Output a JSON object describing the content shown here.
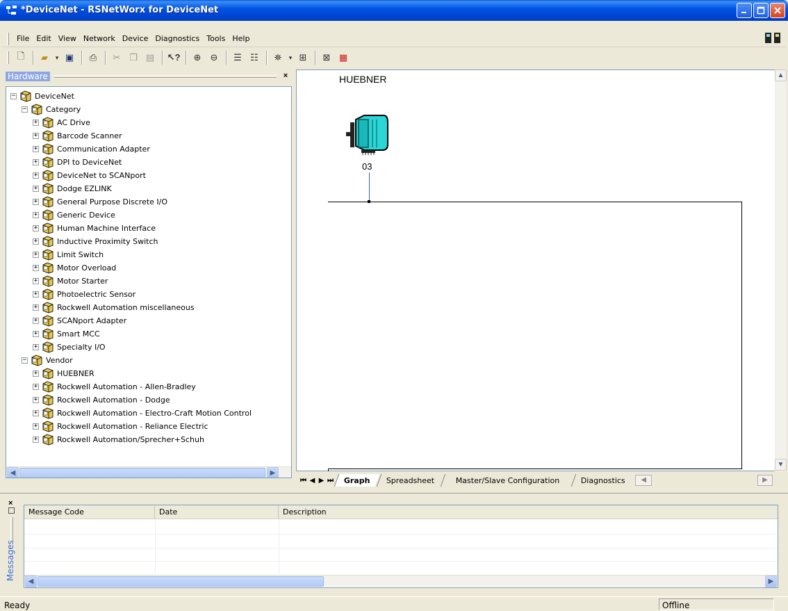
{
  "window": {
    "title": "*DeviceNet - RSNetWorx for DeviceNet"
  },
  "menu": {
    "items": [
      {
        "label": "File"
      },
      {
        "label": "Edit"
      },
      {
        "label": "View"
      },
      {
        "label": "Network"
      },
      {
        "label": "Device"
      },
      {
        "label": "Diagnostics"
      },
      {
        "label": "Tools"
      },
      {
        "label": "Help"
      }
    ]
  },
  "hardware": {
    "title": "Hardware",
    "tree": [
      {
        "label": "DeviceNet",
        "expander": "−"
      },
      {
        "label": "Category",
        "expander": "−"
      },
      {
        "label": "AC Drive",
        "expander": "+"
      },
      {
        "label": "Barcode Scanner",
        "expander": "+"
      },
      {
        "label": "Communication Adapter",
        "expander": "+"
      },
      {
        "label": "DPI to DeviceNet",
        "expander": "+"
      },
      {
        "label": "DeviceNet to SCANport",
        "expander": "+"
      },
      {
        "label": "Dodge EZLINK",
        "expander": "+"
      },
      {
        "label": "General Purpose Discrete I/O",
        "expander": "+"
      },
      {
        "label": "Generic Device",
        "expander": "+"
      },
      {
        "label": "Human Machine Interface",
        "expander": "+"
      },
      {
        "label": "Inductive Proximity Switch",
        "expander": "+"
      },
      {
        "label": "Limit Switch",
        "expander": "+"
      },
      {
        "label": "Motor Overload",
        "expander": "+"
      },
      {
        "label": "Motor Starter",
        "expander": "+"
      },
      {
        "label": "Photoelectric Sensor",
        "expander": "+"
      },
      {
        "label": "Rockwell Automation miscellaneous",
        "expander": "+"
      },
      {
        "label": "SCANport Adapter",
        "expander": "+"
      },
      {
        "label": "Smart MCC",
        "expander": "+"
      },
      {
        "label": "Specialty I/O",
        "expander": "+"
      },
      {
        "label": "Vendor",
        "expander": "−"
      },
      {
        "label": "HUEBNER",
        "expander": "+"
      },
      {
        "label": "Rockwell Automation - Allen-Bradley",
        "expander": "+"
      },
      {
        "label": "Rockwell Automation - Dodge",
        "expander": "+"
      },
      {
        "label": "Rockwell Automation - Electro-Craft Motion Control",
        "expander": "+"
      },
      {
        "label": "Rockwell Automation - Reliance Electric",
        "expander": "+"
      },
      {
        "label": "Rockwell Automation/Sprecher+Schuh",
        "expander": "+"
      }
    ]
  },
  "graph": {
    "network_label": "HUEBNER",
    "node": {
      "address": "03",
      "icon": "drive-device-icon",
      "color": "#2ad6d6"
    }
  },
  "tabs": [
    {
      "label": "Graph",
      "active": true
    },
    {
      "label": "Spreadsheet",
      "active": false
    },
    {
      "label": "Master/Slave Configuration",
      "active": false
    },
    {
      "label": "Diagnostics",
      "active": false
    }
  ],
  "messages": {
    "pane_title": "Messages",
    "columns": [
      "Message Code",
      "Date",
      "Description"
    ]
  },
  "status": {
    "left": "Ready",
    "right": "Offline"
  },
  "colors": {
    "titlebar": "#0055e5",
    "panel_bg": "#ece9d8",
    "folder": "#e8c94a"
  }
}
